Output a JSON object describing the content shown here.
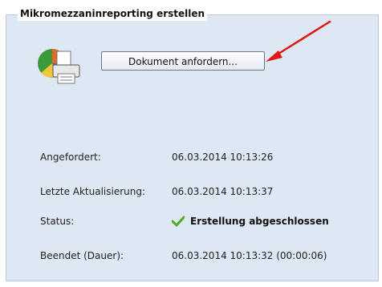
{
  "panel": {
    "title": "Mikromezzaninreporting erstellen",
    "button_label": "Dokument anfordern...",
    "document_icon": "document-printer-icon"
  },
  "annotation": {
    "arrow_icon": "red-arrow-icon",
    "arrow_color": "#e3150f"
  },
  "details": {
    "requested_label": "Angefordert:",
    "requested_value": "06.03.2014 10:13:26",
    "last_update_label": "Letzte Aktualisierung:",
    "last_update_value": "06.03.2014 10:13:37",
    "status_label": "Status:",
    "status_value": "Erstellung abgeschlossen",
    "status_icon": "checkmark-icon",
    "status_color": "#4caf1a",
    "finished_label": "Beendet (Dauer):",
    "finished_value": "06.03.2014 10:13:32 (00:00:06)"
  }
}
